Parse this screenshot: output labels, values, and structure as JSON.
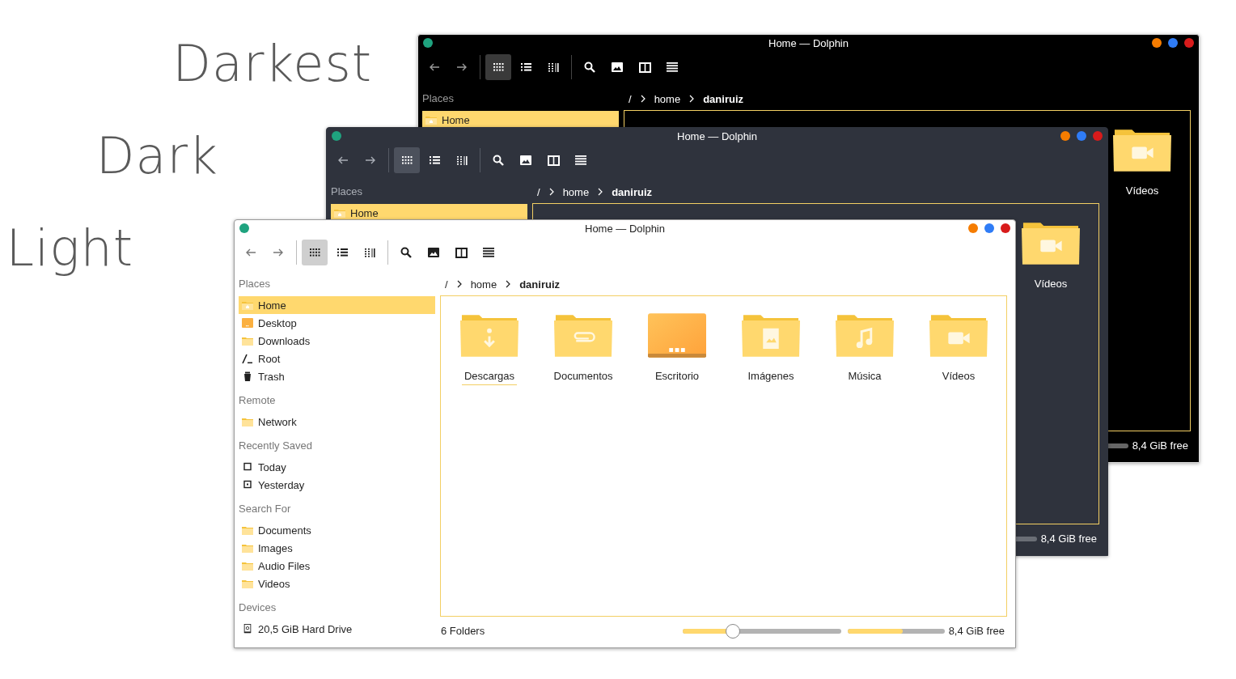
{
  "windows": [
    {
      "kind": "darkest",
      "theme_label": "Darkest",
      "title": "Home — Dolphin",
      "view_modes": [
        {
          "selected": true
        },
        {
          "selected": false
        },
        {
          "selected": false
        }
      ],
      "sidebar": [
        {
          "header": "Places",
          "items": [
            {
              "label": "Home",
              "kind": "home",
              "selected": true
            }
          ]
        }
      ],
      "breadcrumb": [
        {
          "label": "/",
          "current": false
        },
        {
          "label": "home",
          "current": false
        },
        {
          "label": "daniruiz",
          "current": true
        }
      ],
      "folders": [
        {
          "name": "Vídeos",
          "kind": "video",
          "focused": false
        }
      ],
      "status": {
        "storage_bar": true,
        "free_space": "8,4 GiB free"
      }
    },
    {
      "kind": "dark",
      "theme_label": "Dark",
      "title": "Home — Dolphin",
      "view_modes": [
        {
          "selected": true
        },
        {
          "selected": false
        },
        {
          "selected": false
        }
      ],
      "sidebar": [
        {
          "header": "Places",
          "items": [
            {
              "label": "Home",
              "kind": "home",
              "selected": true
            }
          ]
        }
      ],
      "breadcrumb": [
        {
          "label": "/",
          "current": false
        },
        {
          "label": "home",
          "current": false
        },
        {
          "label": "daniruiz",
          "current": true
        }
      ],
      "folders": [
        {
          "name": "Vídeos",
          "kind": "video",
          "focused": false
        }
      ],
      "status": {
        "storage_bar": true,
        "free_space": "8,4 GiB free"
      }
    },
    {
      "kind": "light",
      "theme_label": "Light",
      "title": "Home — Dolphin",
      "view_modes": [
        {
          "selected": true
        },
        {
          "selected": false
        },
        {
          "selected": false
        }
      ],
      "sidebar": [
        {
          "header": "Places",
          "items": [
            {
              "label": "Home",
              "kind": "home",
              "selected": true
            },
            {
              "label": "Desktop",
              "kind": "desktop",
              "selected": false
            },
            {
              "label": "Downloads",
              "kind": "downloads",
              "selected": false
            },
            {
              "label": "Root",
              "kind": "root",
              "selected": false
            },
            {
              "label": "Trash",
              "kind": "trash",
              "selected": false
            }
          ]
        },
        {
          "header": "Remote",
          "items": [
            {
              "label": "Network",
              "kind": "network",
              "selected": false
            }
          ]
        },
        {
          "header": "Recently Saved",
          "items": [
            {
              "label": "Today",
              "kind": "today",
              "selected": false
            },
            {
              "label": "Yesterday",
              "kind": "yesterday",
              "selected": false
            }
          ]
        },
        {
          "header": "Search For",
          "items": [
            {
              "label": "Documents",
              "kind": "folder",
              "selected": false
            },
            {
              "label": "Images",
              "kind": "folder",
              "selected": false
            },
            {
              "label": "Audio Files",
              "kind": "folder",
              "selected": false
            },
            {
              "label": "Videos",
              "kind": "folder",
              "selected": false
            }
          ]
        },
        {
          "header": "Devices",
          "items": [
            {
              "label": "20,5 GiB Hard Drive",
              "kind": "drive",
              "selected": false
            }
          ]
        }
      ],
      "breadcrumb": [
        {
          "label": "/",
          "current": false
        },
        {
          "label": "home",
          "current": false
        },
        {
          "label": "daniruiz",
          "current": true
        }
      ],
      "folders": [
        {
          "name": "Descargas",
          "kind": "download",
          "focused": true
        },
        {
          "name": "Documentos",
          "kind": "documents",
          "focused": false
        },
        {
          "name": "Escritorio",
          "kind": "desktop",
          "focused": false
        },
        {
          "name": "Imágenes",
          "kind": "images",
          "focused": false
        },
        {
          "name": "Música",
          "kind": "music",
          "focused": false
        },
        {
          "name": "Vídeos",
          "kind": "video",
          "focused": false
        }
      ],
      "status": {
        "item_count": "6 Folders",
        "zoom": {
          "level": 0.32
        },
        "storage": {
          "level": 0.57
        },
        "free_space": "8,4 GiB free"
      }
    }
  ]
}
